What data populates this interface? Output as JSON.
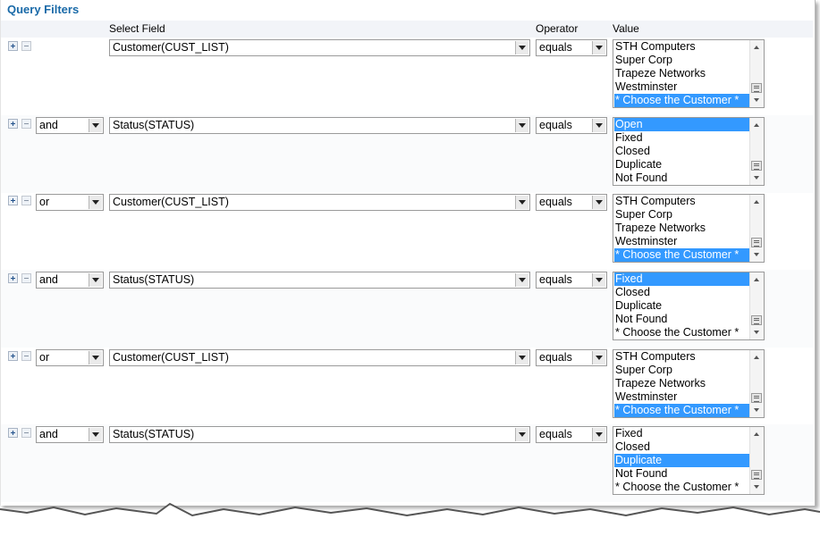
{
  "title": "Query Filters",
  "headers": {
    "select_field": "Select Field",
    "operator": "Operator",
    "value": "Value"
  },
  "icons": {
    "add": "plus-icon",
    "remove": "minus-icon",
    "dropdown": "chevron-down-icon"
  },
  "colors": {
    "title": "#1a6aa8",
    "selection": "#3399ff"
  },
  "rows": [
    {
      "conjunction": "",
      "field": "Customer(CUST_LIST)",
      "operator": "equals",
      "options": [
        "STH Computers",
        "Super Corp",
        "Trapeze Networks",
        "Westminster",
        "* Choose the Customer *"
      ],
      "selected": 4
    },
    {
      "conjunction": "and",
      "field": "Status(STATUS)",
      "operator": "equals",
      "options": [
        "Open",
        "Fixed",
        "Closed",
        "Duplicate",
        "Not Found"
      ],
      "selected": 0
    },
    {
      "conjunction": "or",
      "field": "Customer(CUST_LIST)",
      "operator": "equals",
      "options": [
        "STH Computers",
        "Super Corp",
        "Trapeze Networks",
        "Westminster",
        "* Choose the Customer *"
      ],
      "selected": 4
    },
    {
      "conjunction": "and",
      "field": "Status(STATUS)",
      "operator": "equals",
      "options": [
        "Fixed",
        "Closed",
        "Duplicate",
        "Not Found",
        "* Choose the Customer *"
      ],
      "selected": 0
    },
    {
      "conjunction": "or",
      "field": "Customer(CUST_LIST)",
      "operator": "equals",
      "options": [
        "STH Computers",
        "Super Corp",
        "Trapeze Networks",
        "Westminster",
        "* Choose the Customer *"
      ],
      "selected": 4
    },
    {
      "conjunction": "and",
      "field": "Status(STATUS)",
      "operator": "equals",
      "options": [
        "Fixed",
        "Closed",
        "Duplicate",
        "Not Found",
        "* Choose the Customer *"
      ],
      "selected": 2
    }
  ]
}
